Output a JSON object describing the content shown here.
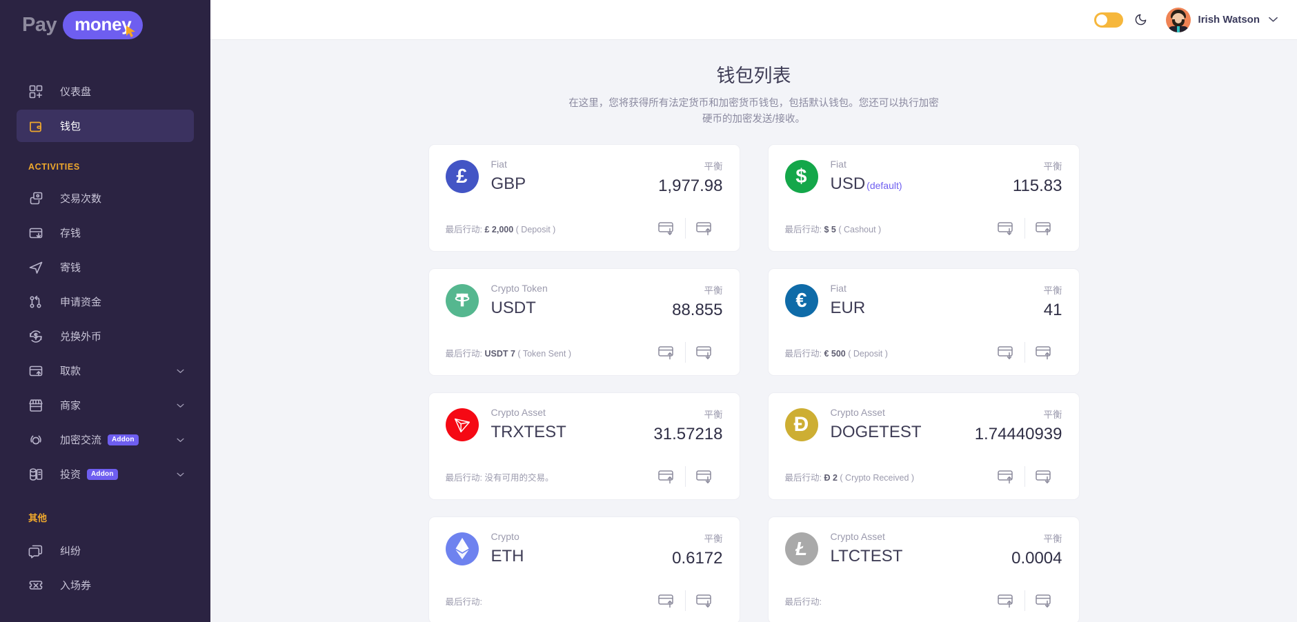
{
  "brand": {
    "pay": "Pay",
    "money": "money"
  },
  "sidebar": {
    "sections": [
      {
        "label": "",
        "items": [
          {
            "label": "仪表盘",
            "icon": "dashboard-icon",
            "active": false,
            "expandable": false,
            "addon": ""
          },
          {
            "label": "钱包",
            "icon": "wallet-icon",
            "active": true,
            "expandable": false,
            "addon": ""
          }
        ]
      },
      {
        "label": "ACTIVITIES",
        "items": [
          {
            "label": "交易次数",
            "icon": "transactions-icon",
            "active": false,
            "expandable": false,
            "addon": ""
          },
          {
            "label": "存钱",
            "icon": "deposit-icon",
            "active": false,
            "expandable": false,
            "addon": ""
          },
          {
            "label": "寄钱",
            "icon": "send-icon",
            "active": false,
            "expandable": false,
            "addon": ""
          },
          {
            "label": "申请资金",
            "icon": "request-funds-icon",
            "active": false,
            "expandable": false,
            "addon": ""
          },
          {
            "label": "兑换外币",
            "icon": "exchange-icon",
            "active": false,
            "expandable": false,
            "addon": ""
          },
          {
            "label": "取款",
            "icon": "withdraw-icon",
            "active": false,
            "expandable": true,
            "addon": ""
          },
          {
            "label": "商家",
            "icon": "merchant-icon",
            "active": false,
            "expandable": true,
            "addon": ""
          },
          {
            "label": "加密交流",
            "icon": "crypto-exchange-icon",
            "active": false,
            "expandable": true,
            "addon": "Addon"
          },
          {
            "label": "投资",
            "icon": "investment-icon",
            "active": false,
            "expandable": true,
            "addon": "Addon"
          }
        ]
      },
      {
        "label": "其他",
        "items": [
          {
            "label": "纠纷",
            "icon": "dispute-icon",
            "active": false,
            "expandable": false,
            "addon": ""
          },
          {
            "label": "入场券",
            "icon": "ticket-icon",
            "active": false,
            "expandable": false,
            "addon": ""
          }
        ]
      }
    ]
  },
  "topbar": {
    "theme_toggle_state": "off",
    "moon_icon": "moon-icon",
    "user_name": "Irish Watson",
    "user_chevron": "chevron-down-icon"
  },
  "page": {
    "title": "钱包列表",
    "subtitle": "在这里，您将获得所有法定货币和加密货币钱包，包括默认钱包。您还可以执行加密硬币的加密发送/接收。",
    "balance_label": "平衡",
    "last_action_label": "最后行动:"
  },
  "colors": {
    "sidebar_bg": "#2b2342",
    "sidebar_active": "#3b3260",
    "accent_purple": "#6e5ef0",
    "accent_orange": "#f0a92c",
    "content_bg": "#f3f4f8"
  },
  "wallets": [
    {
      "type": "Fiat",
      "code": "GBP",
      "default_tag": "",
      "balance": "1,977.98",
      "symbol": "£",
      "icon": "gbp-coin-icon",
      "icon_bg": "#4355c5",
      "last_action_amount": "£ 2,000",
      "last_action_kind": "( Deposit )",
      "actions": [
        "deposit-icon",
        "withdraw-icon"
      ]
    },
    {
      "type": "Fiat",
      "code": "USD",
      "default_tag": "(default)",
      "balance": "115.83",
      "symbol": "$",
      "icon": "usd-coin-icon",
      "icon_bg": "#14a74a",
      "last_action_amount": "$ 5",
      "last_action_kind": "( Cashout )",
      "actions": [
        "deposit-icon",
        "withdraw-icon"
      ]
    },
    {
      "type": "Crypto Token",
      "code": "USDT",
      "default_tag": "",
      "balance": "88.855",
      "symbol": "₮",
      "icon": "usdt-coin-icon",
      "icon_bg": "#55b78f",
      "last_action_amount": "USDT 7",
      "last_action_kind": "( Token Sent )",
      "actions": [
        "send-crypto-icon",
        "receive-crypto-icon"
      ]
    },
    {
      "type": "Fiat",
      "code": "EUR",
      "default_tag": "",
      "balance": "41",
      "symbol": "€",
      "icon": "eur-coin-icon",
      "icon_bg": "#0f6ba8",
      "last_action_amount": "€ 500",
      "last_action_kind": "( Deposit )",
      "actions": [
        "deposit-icon",
        "withdraw-icon"
      ]
    },
    {
      "type": "Crypto Asset",
      "code": "TRXTEST",
      "default_tag": "",
      "balance": "31.57218",
      "symbol": "",
      "icon": "tron-coin-icon",
      "icon_bg": "#f50914",
      "last_action_amount": "",
      "last_action_kind": "没有可用的交易。",
      "actions": [
        "send-crypto-icon",
        "receive-crypto-icon"
      ]
    },
    {
      "type": "Crypto Asset",
      "code": "DOGETEST",
      "default_tag": "",
      "balance": "1.74440939",
      "symbol": "Ð",
      "icon": "doge-coin-icon",
      "icon_bg": "#cdae33",
      "last_action_amount": "Ð 2",
      "last_action_kind": "( Crypto Received )",
      "actions": [
        "send-crypto-icon",
        "receive-crypto-icon"
      ]
    },
    {
      "type": "Crypto",
      "code": "ETH",
      "default_tag": "",
      "balance": "0.6172",
      "symbol": "",
      "icon": "eth-coin-icon",
      "icon_bg": "#6e82ef",
      "last_action_amount": "",
      "last_action_kind": "",
      "actions": [
        "send-crypto-icon",
        "receive-crypto-icon"
      ]
    },
    {
      "type": "Crypto Asset",
      "code": "LTCTEST",
      "default_tag": "",
      "balance": "0.0004",
      "symbol": "Ł",
      "icon": "ltc-coin-icon",
      "icon_bg": "#a9a9a9",
      "last_action_amount": "",
      "last_action_kind": "",
      "actions": [
        "send-crypto-icon",
        "receive-crypto-icon"
      ]
    }
  ]
}
